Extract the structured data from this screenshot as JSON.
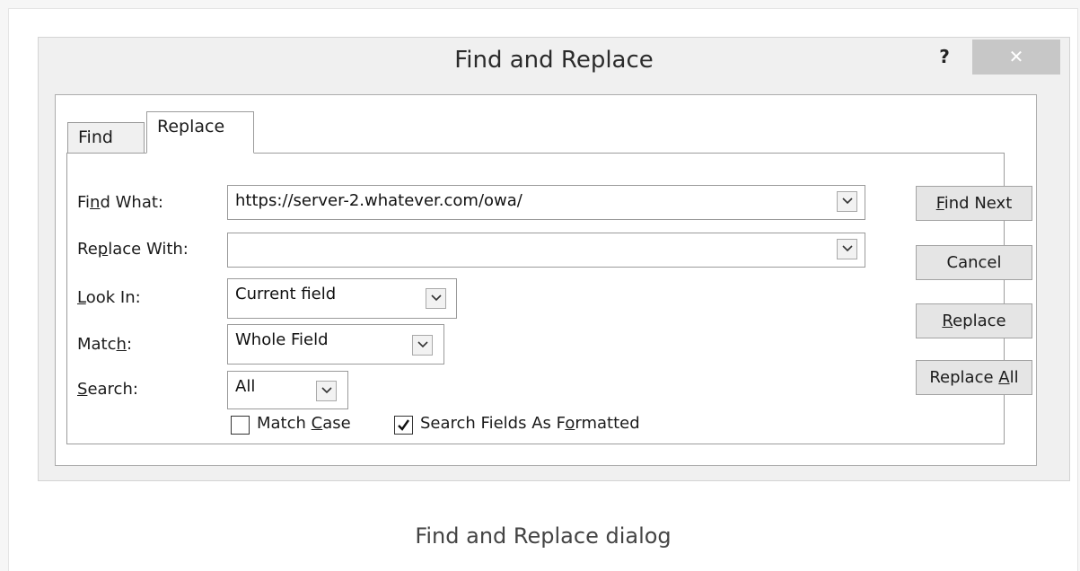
{
  "dialog": {
    "title": "Find and Replace",
    "help_label": "?",
    "close_label": "✕"
  },
  "tabs": [
    {
      "label": "Find",
      "selected": false
    },
    {
      "label": "Replace",
      "selected": true
    }
  ],
  "fields": {
    "find_what": {
      "label_pre": "Fi",
      "label_key": "n",
      "label_post": "d What:",
      "value": "https://server-2.whatever.com/owa/"
    },
    "replace_with": {
      "label_pre": "Re",
      "label_key": "p",
      "label_post": "lace With:",
      "value": ""
    },
    "look_in": {
      "label_pre": "",
      "label_key": "L",
      "label_post": "ook In:",
      "value": "Current field"
    },
    "match": {
      "label_pre": "Matc",
      "label_key": "h",
      "label_post": ":",
      "value": "Whole Field"
    },
    "search": {
      "label_pre": "",
      "label_key": "S",
      "label_post": "earch:",
      "value": "All"
    }
  },
  "checkboxes": {
    "match_case": {
      "pre": "Match ",
      "key": "C",
      "post": "ase",
      "checked": false
    },
    "search_formatted": {
      "pre": "Search Fields As F",
      "key": "o",
      "post": "rmatted",
      "checked": true
    }
  },
  "buttons": {
    "find_next": {
      "pre": "",
      "key": "F",
      "post": "ind Next"
    },
    "cancel": {
      "pre": "",
      "key": "",
      "post": "Cancel"
    },
    "replace": {
      "pre": "",
      "key": "R",
      "post": "eplace"
    },
    "replace_all": {
      "pre": "Replace ",
      "key": "A",
      "post": "ll"
    }
  },
  "caption": "Find and Replace dialog",
  "icons": {
    "dropdown": "chevron-down-icon",
    "check": "check-icon"
  },
  "colors": {
    "dialog_bg": "#f0f0f0",
    "close_bg": "#c7c7c7",
    "button_bg": "#e5e5e5"
  }
}
